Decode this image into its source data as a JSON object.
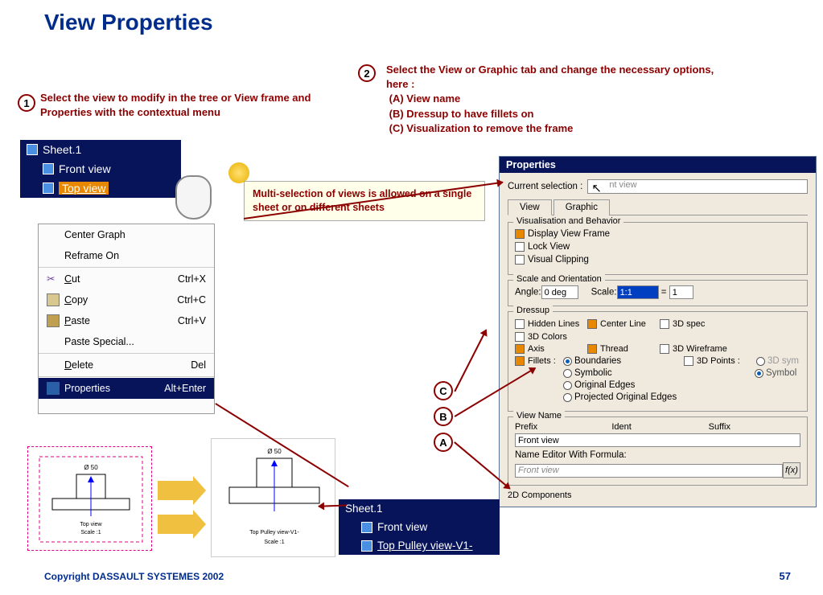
{
  "title": "View Properties",
  "step1": {
    "num": "1",
    "text": "Select the view to modify in the tree or View frame and Properties with the contextual menu"
  },
  "step2": {
    "num": "2",
    "text": "Select the View or Graphic tab and change the necessary options, here :",
    "lines": [
      "(A) View name",
      "(B) Dressup to have fillets on",
      "(C) Visualization to remove the frame"
    ]
  },
  "tree": {
    "sheet": "Sheet.1",
    "items": [
      "Front view",
      "Top view"
    ]
  },
  "callout": "Multi-selection of views is allowed on a single sheet or on different sheets",
  "context": [
    {
      "label": "Center Graph",
      "short": "",
      "sep": false
    },
    {
      "label": "Reframe On",
      "short": "",
      "sep": false
    },
    {
      "label": "Cut",
      "short": "Ctrl+X",
      "icon": "scissors",
      "sep": true
    },
    {
      "label": "Copy",
      "short": "Ctrl+C",
      "icon": "copy",
      "sep": false
    },
    {
      "label": "Paste",
      "short": "Ctrl+V",
      "icon": "paste",
      "sep": false
    },
    {
      "label": "Paste Special...",
      "short": "",
      "sep": false
    },
    {
      "label": "Delete",
      "short": "Del",
      "sep": true
    },
    {
      "label": "Properties",
      "short": "Alt+Enter",
      "icon": "props",
      "sep": true,
      "sel": true
    }
  ],
  "letters": [
    "C",
    "B",
    "A"
  ],
  "props": {
    "title": "Properties",
    "curselLabel": "Current selection :",
    "curselValue": "nt view",
    "tabs": [
      "View",
      "Graphic"
    ],
    "vis": {
      "label": "Visualisation and Behavior",
      "items": [
        {
          "t": "Display View Frame",
          "on": true
        },
        {
          "t": "Lock View",
          "on": false
        },
        {
          "t": "Visual Clipping",
          "on": false
        }
      ]
    },
    "scale": {
      "label": "Scale and Orientation",
      "angle": "Angle:",
      "angleVal": "0 deg",
      "scale": "Scale:",
      "scaleVal": "1:1",
      "eq": "=",
      "one": "1"
    },
    "dress": {
      "label": "Dressup",
      "items": [
        [
          "Hidden Lines",
          false
        ],
        [
          "Center Line",
          true
        ],
        [
          "3D spec",
          false
        ],
        [
          "3D Colors",
          false
        ],
        [
          "Axis",
          true
        ],
        [
          "Thread",
          true
        ],
        [
          "3D Wireframe",
          false
        ],
        [
          "",
          null
        ],
        [
          "Fillets :",
          true
        ]
      ],
      "filletRadios": [
        "Boundaries",
        "Symbolic",
        "Original Edges",
        "Projected Original Edges"
      ],
      "points": "3D Points :",
      "symOpt": "3D sym",
      "symOpt2": "Symbol"
    },
    "viewName": {
      "label": "View Name",
      "cols": [
        "Prefix",
        "Ident",
        "Suffix"
      ],
      "val": "Front view",
      "formula": "Name Editor With Formula:",
      "formulaVal": "Front view",
      "fx": "f(x)"
    },
    "comp2d": "2D Components"
  },
  "thumb": {
    "c1": "Ø 50",
    "c2": "Ø 50",
    "cap1a": "Top view",
    "cap1b": "Scale :1",
    "cap2a": "Top Pulley view-V1-",
    "cap2b": "Scale :1"
  },
  "tree2": {
    "sheet": "Sheet.1",
    "v1": "Front view",
    "v2": "Top Pulley view-V1-"
  },
  "footer": "Copyright DASSAULT SYSTEMES 2002",
  "page": "57"
}
